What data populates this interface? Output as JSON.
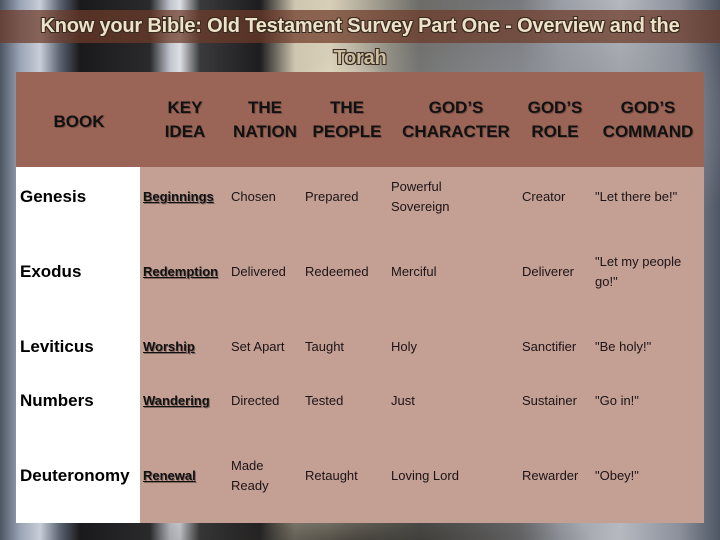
{
  "title": {
    "line1": "Know your Bible: Old Testament Survey Part One - Overview and the",
    "line2": "Torah"
  },
  "colors": {
    "header_bg": "#9a6456",
    "body_bg": "#c49f94",
    "book_col_bg": "#ffffff",
    "title_band": "#6e3a28",
    "title_text": "#ede3c8"
  },
  "table": {
    "headers": [
      "BOOK",
      "KEY\nIDEA",
      "THE\nNATION",
      "THE\nPEOPLE",
      "GOD’S\nCHARACTER",
      "GOD’S\nROLE",
      "GOD’S\nCOMMAND"
    ],
    "rows": [
      {
        "book": "Genesis",
        "key_idea": "Beginnings",
        "nation": "Chosen",
        "people": "Prepared",
        "character": "Powerful\nSovereign",
        "role": "Creator",
        "command": "\"Let there be!\""
      },
      {
        "book": "Exodus",
        "key_idea": "Redemption",
        "nation": "Delivered",
        "people": "Redeemed",
        "character": "Merciful",
        "role": "Deliverer",
        "command": "\"Let my people\ngo!\""
      },
      {
        "book": "Leviticus",
        "key_idea": "Worship",
        "nation": "Set Apart",
        "people": "Taught",
        "character": "Holy",
        "role": "Sanctifier",
        "command": "\"Be holy!\""
      },
      {
        "book": "Numbers",
        "key_idea": "Wandering",
        "nation": "Directed",
        "people": "Tested",
        "character": "Just",
        "role": "Sustainer",
        "command": "\"Go in!\""
      },
      {
        "book": "Deuteronomy",
        "key_idea": "Renewal",
        "nation": "Made\nReady",
        "people": "Retaught",
        "character": "Loving Lord",
        "role": "Rewarder",
        "command": "\"Obey!\""
      }
    ]
  }
}
